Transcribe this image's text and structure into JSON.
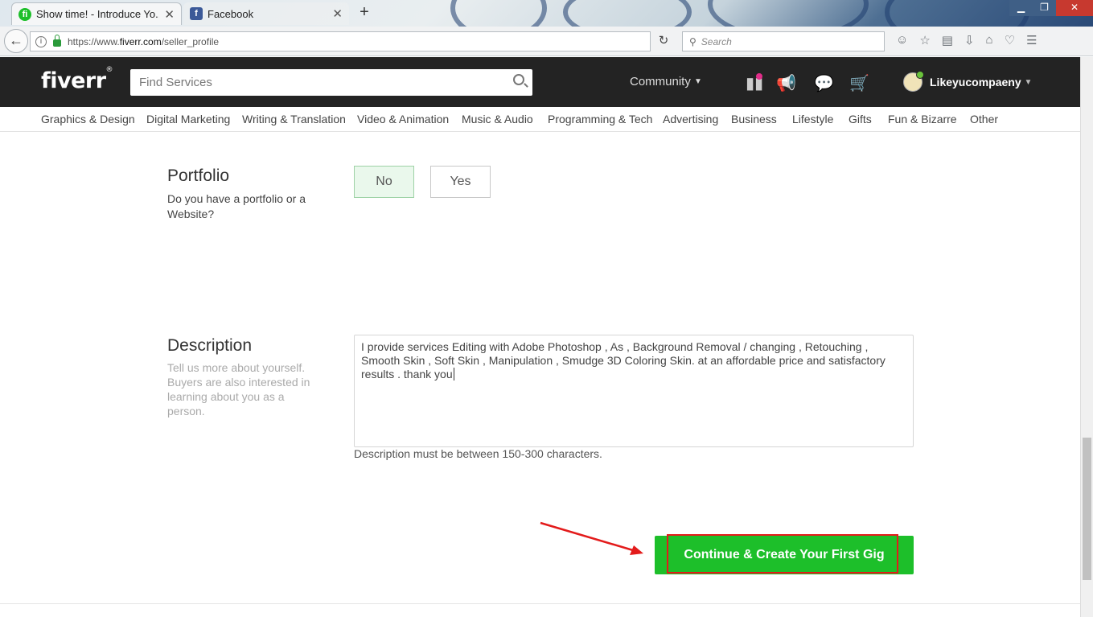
{
  "browser": {
    "tabs": [
      {
        "label": "Show time! - Introduce Yo...",
        "favicon": "fi"
      },
      {
        "label": "Facebook",
        "favicon": "f"
      }
    ],
    "new_tab": "+",
    "url_prefix": "https://www.",
    "url_domain": "fiverr.com",
    "url_path": "/seller_profile",
    "search_placeholder": "Search"
  },
  "header": {
    "logo": "fiverr",
    "logo_mark": "®",
    "search_placeholder": "Find Services",
    "community": "Community",
    "username": "Likeyucompaeny"
  },
  "categories": [
    "Graphics & Design",
    "Digital Marketing",
    "Writing & Translation",
    "Video & Animation",
    "Music & Audio",
    "Programming & Tech",
    "Advertising",
    "Business",
    "Lifestyle",
    "Gifts",
    "Fun & Bizarre",
    "Other"
  ],
  "portfolio": {
    "title": "Portfolio",
    "question": "Do you have a portfolio or a Website?",
    "options": [
      "No",
      "Yes"
    ],
    "selected": "No"
  },
  "description": {
    "title": "Description",
    "help": "Tell us more about yourself. Buyers are also interested in learning about you as a person.",
    "value": "I provide services Editing with Adobe Photoshop , As , Background Removal / changing , Retouching , Smooth Skin , Soft Skin , Manipulation , Smudge 3D Coloring Skin. at an affordable price and satisfactory results . thank you",
    "hint": "Description must be between 150-300 characters."
  },
  "cta": {
    "label": "Continue & Create Your First Gig"
  },
  "colors": {
    "accent": "#1dbf2a",
    "header_bg": "#232323",
    "annotation": "#e31b1b"
  }
}
